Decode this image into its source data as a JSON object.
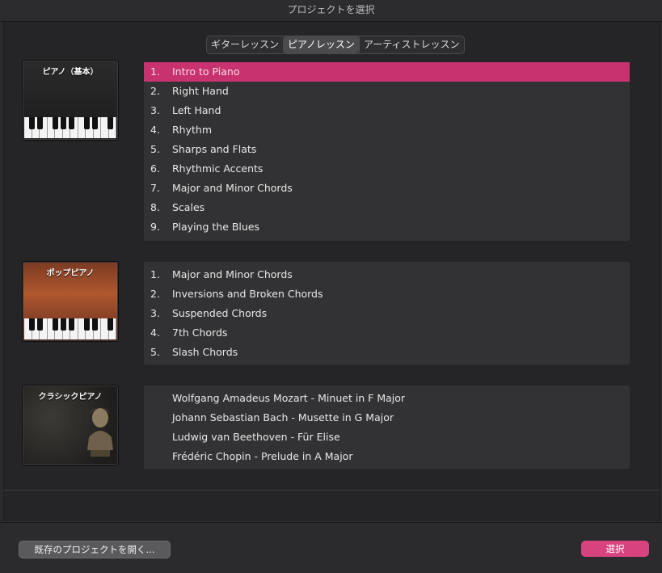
{
  "window": {
    "title": "プロジェクトを選択"
  },
  "tabs": [
    {
      "label": "ギターレッスン",
      "active": false
    },
    {
      "label": "ピアノレッスン",
      "active": true
    },
    {
      "label": "アーティストレッスン",
      "active": false
    }
  ],
  "sections": [
    {
      "thumb_label": "ピアノ（基本）",
      "items": [
        {
          "num": "1.",
          "text": "Intro to Piano"
        },
        {
          "num": "2.",
          "text": "Right Hand"
        },
        {
          "num": "3.",
          "text": "Left Hand"
        },
        {
          "num": "4.",
          "text": "Rhythm"
        },
        {
          "num": "5.",
          "text": "Sharps and Flats"
        },
        {
          "num": "6.",
          "text": "Rhythmic Accents"
        },
        {
          "num": "7.",
          "text": "Major and Minor Chords"
        },
        {
          "num": "8.",
          "text": "Scales"
        },
        {
          "num": "9.",
          "text": "Playing the Blues"
        }
      ]
    },
    {
      "thumb_label": "ポップピアノ",
      "items": [
        {
          "num": "1.",
          "text": "Major and Minor Chords"
        },
        {
          "num": "2.",
          "text": "Inversions and Broken Chords"
        },
        {
          "num": "3.",
          "text": "Suspended Chords"
        },
        {
          "num": "4.",
          "text": "7th Chords"
        },
        {
          "num": "5.",
          "text": "Slash Chords"
        }
      ]
    },
    {
      "thumb_label": "クラシックピアノ",
      "items": [
        {
          "num": "",
          "text": "Wolfgang Amadeus Mozart - Minuet in F Major"
        },
        {
          "num": "",
          "text": "Johann Sebastian Bach - Musette in G Major"
        },
        {
          "num": "",
          "text": "Ludwig van Beethoven - Für Elise"
        },
        {
          "num": "",
          "text": "Frédéric Chopin - Prelude in A Major"
        }
      ]
    }
  ],
  "footer": {
    "open_label": "既存のプロジェクトを開く...",
    "select_label": "選択"
  },
  "colors": {
    "accent": "#d6437f",
    "selected_row": "#c8336f"
  }
}
